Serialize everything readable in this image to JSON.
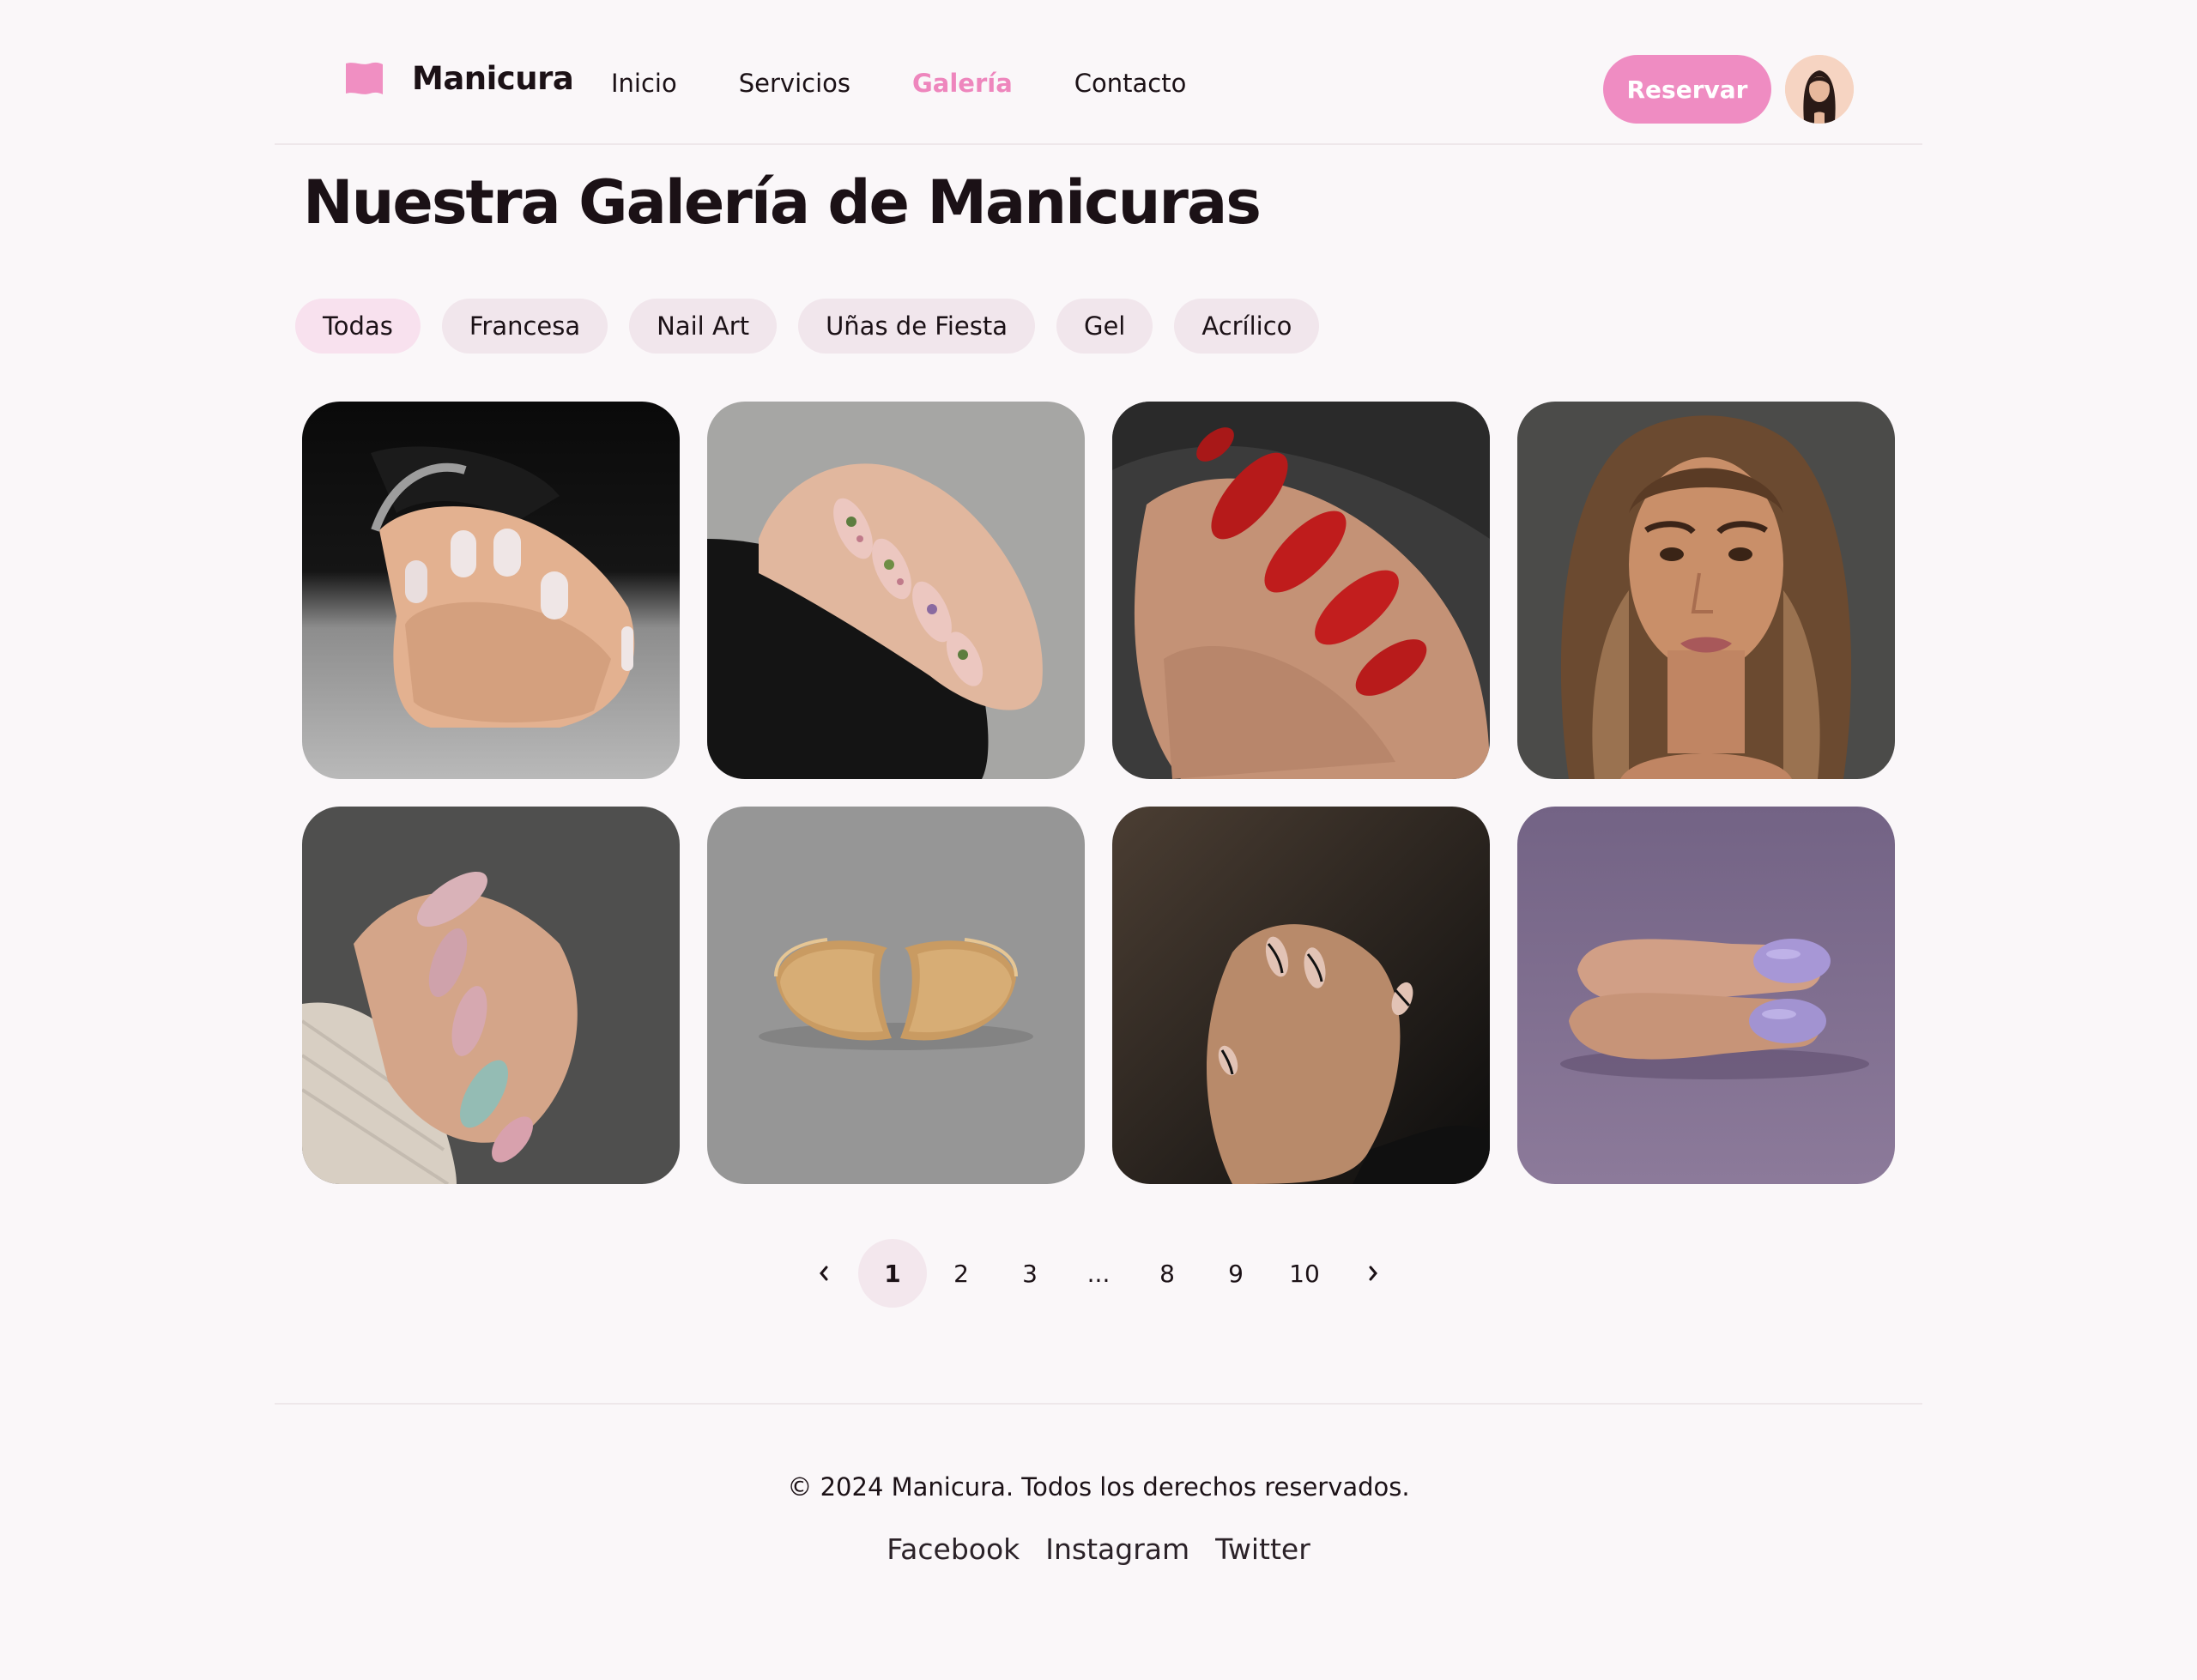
{
  "header": {
    "brand_name": "Manicura",
    "nav": [
      "Inicio",
      "Servicios",
      "Galería",
      "Contacto"
    ],
    "active_nav": "Galería",
    "reserve_label": "Reservar",
    "accent_color": "#ef8cc2"
  },
  "main": {
    "title": "Nuestra Galería de Manicuras",
    "filters": [
      "Todas",
      "Francesa",
      "Nail Art",
      "Uñas de Fiesta",
      "Gel",
      "Acrílico"
    ],
    "active_filter": "Todas",
    "gallery": [
      {
        "subject": "hand-nude-nails-photo"
      },
      {
        "subject": "hand-floral-nail-art-photo"
      },
      {
        "subject": "hand-red-nails-photo"
      },
      {
        "subject": "woman-portrait-photo"
      },
      {
        "subject": "hand-pastel-nails-photo"
      },
      {
        "subject": "gold-bracelet-photo"
      },
      {
        "subject": "hand-minimal-line-nails-photo"
      },
      {
        "subject": "hand-lavender-nails-photo"
      }
    ]
  },
  "pagination": {
    "prev_icon": "chevron-left-icon",
    "pages": [
      "1",
      "2",
      "3",
      "...",
      "8",
      "9",
      "10"
    ],
    "current": "1",
    "next_icon": "chevron-right-icon"
  },
  "footer": {
    "copyright": "© 2024 Manicura. Todos los derechos reservados.",
    "social": [
      "Facebook",
      "Instagram",
      "Twitter"
    ]
  }
}
